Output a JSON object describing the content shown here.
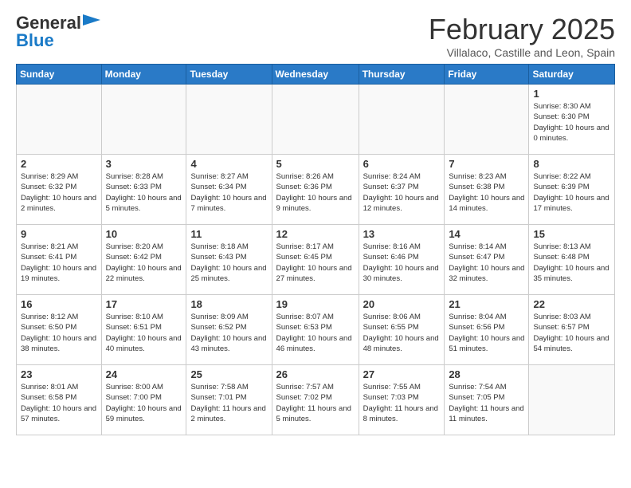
{
  "header": {
    "logo_general": "General",
    "logo_blue": "Blue",
    "title": "February 2025",
    "subtitle": "Villalaco, Castille and Leon, Spain"
  },
  "days_of_week": [
    "Sunday",
    "Monday",
    "Tuesday",
    "Wednesday",
    "Thursday",
    "Friday",
    "Saturday"
  ],
  "weeks": [
    [
      {
        "day": "",
        "info": ""
      },
      {
        "day": "",
        "info": ""
      },
      {
        "day": "",
        "info": ""
      },
      {
        "day": "",
        "info": ""
      },
      {
        "day": "",
        "info": ""
      },
      {
        "day": "",
        "info": ""
      },
      {
        "day": "1",
        "info": "Sunrise: 8:30 AM\nSunset: 6:30 PM\nDaylight: 10 hours and 0 minutes."
      }
    ],
    [
      {
        "day": "2",
        "info": "Sunrise: 8:29 AM\nSunset: 6:32 PM\nDaylight: 10 hours and 2 minutes."
      },
      {
        "day": "3",
        "info": "Sunrise: 8:28 AM\nSunset: 6:33 PM\nDaylight: 10 hours and 5 minutes."
      },
      {
        "day": "4",
        "info": "Sunrise: 8:27 AM\nSunset: 6:34 PM\nDaylight: 10 hours and 7 minutes."
      },
      {
        "day": "5",
        "info": "Sunrise: 8:26 AM\nSunset: 6:36 PM\nDaylight: 10 hours and 9 minutes."
      },
      {
        "day": "6",
        "info": "Sunrise: 8:24 AM\nSunset: 6:37 PM\nDaylight: 10 hours and 12 minutes."
      },
      {
        "day": "7",
        "info": "Sunrise: 8:23 AM\nSunset: 6:38 PM\nDaylight: 10 hours and 14 minutes."
      },
      {
        "day": "8",
        "info": "Sunrise: 8:22 AM\nSunset: 6:39 PM\nDaylight: 10 hours and 17 minutes."
      }
    ],
    [
      {
        "day": "9",
        "info": "Sunrise: 8:21 AM\nSunset: 6:41 PM\nDaylight: 10 hours and 19 minutes."
      },
      {
        "day": "10",
        "info": "Sunrise: 8:20 AM\nSunset: 6:42 PM\nDaylight: 10 hours and 22 minutes."
      },
      {
        "day": "11",
        "info": "Sunrise: 8:18 AM\nSunset: 6:43 PM\nDaylight: 10 hours and 25 minutes."
      },
      {
        "day": "12",
        "info": "Sunrise: 8:17 AM\nSunset: 6:45 PM\nDaylight: 10 hours and 27 minutes."
      },
      {
        "day": "13",
        "info": "Sunrise: 8:16 AM\nSunset: 6:46 PM\nDaylight: 10 hours and 30 minutes."
      },
      {
        "day": "14",
        "info": "Sunrise: 8:14 AM\nSunset: 6:47 PM\nDaylight: 10 hours and 32 minutes."
      },
      {
        "day": "15",
        "info": "Sunrise: 8:13 AM\nSunset: 6:48 PM\nDaylight: 10 hours and 35 minutes."
      }
    ],
    [
      {
        "day": "16",
        "info": "Sunrise: 8:12 AM\nSunset: 6:50 PM\nDaylight: 10 hours and 38 minutes."
      },
      {
        "day": "17",
        "info": "Sunrise: 8:10 AM\nSunset: 6:51 PM\nDaylight: 10 hours and 40 minutes."
      },
      {
        "day": "18",
        "info": "Sunrise: 8:09 AM\nSunset: 6:52 PM\nDaylight: 10 hours and 43 minutes."
      },
      {
        "day": "19",
        "info": "Sunrise: 8:07 AM\nSunset: 6:53 PM\nDaylight: 10 hours and 46 minutes."
      },
      {
        "day": "20",
        "info": "Sunrise: 8:06 AM\nSunset: 6:55 PM\nDaylight: 10 hours and 48 minutes."
      },
      {
        "day": "21",
        "info": "Sunrise: 8:04 AM\nSunset: 6:56 PM\nDaylight: 10 hours and 51 minutes."
      },
      {
        "day": "22",
        "info": "Sunrise: 8:03 AM\nSunset: 6:57 PM\nDaylight: 10 hours and 54 minutes."
      }
    ],
    [
      {
        "day": "23",
        "info": "Sunrise: 8:01 AM\nSunset: 6:58 PM\nDaylight: 10 hours and 57 minutes."
      },
      {
        "day": "24",
        "info": "Sunrise: 8:00 AM\nSunset: 7:00 PM\nDaylight: 10 hours and 59 minutes."
      },
      {
        "day": "25",
        "info": "Sunrise: 7:58 AM\nSunset: 7:01 PM\nDaylight: 11 hours and 2 minutes."
      },
      {
        "day": "26",
        "info": "Sunrise: 7:57 AM\nSunset: 7:02 PM\nDaylight: 11 hours and 5 minutes."
      },
      {
        "day": "27",
        "info": "Sunrise: 7:55 AM\nSunset: 7:03 PM\nDaylight: 11 hours and 8 minutes."
      },
      {
        "day": "28",
        "info": "Sunrise: 7:54 AM\nSunset: 7:05 PM\nDaylight: 11 hours and 11 minutes."
      },
      {
        "day": "",
        "info": ""
      }
    ]
  ]
}
